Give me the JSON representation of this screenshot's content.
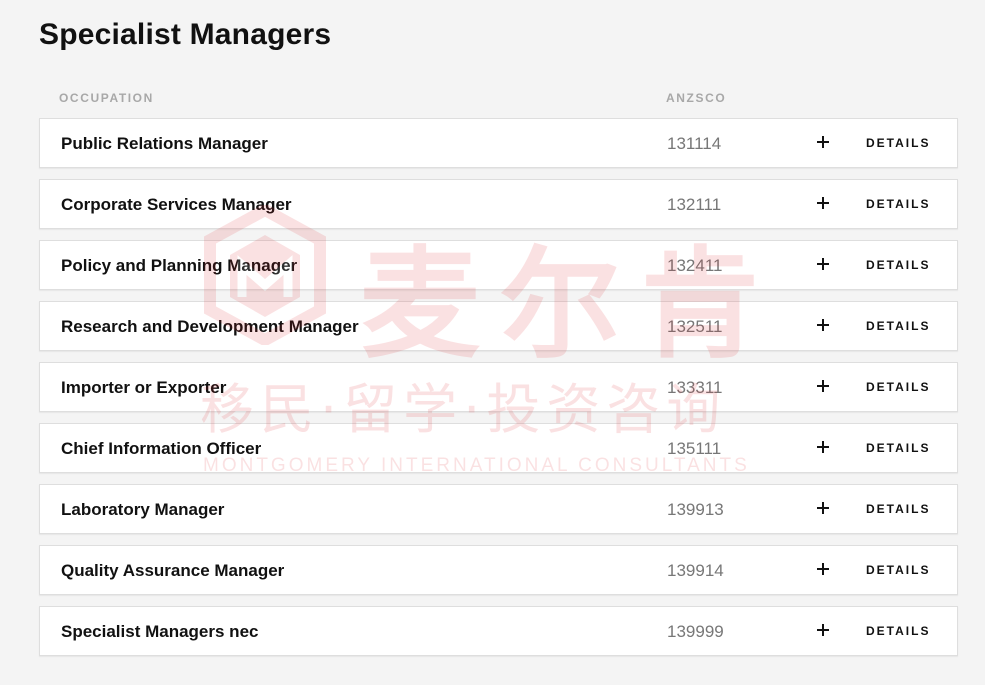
{
  "page": {
    "title": "Specialist Managers"
  },
  "columns": {
    "occupation": "OCCUPATION",
    "anzsco": "ANZSCO"
  },
  "rows": [
    {
      "name": "Public Relations Manager",
      "code": "131114",
      "details_label": "DETAILS"
    },
    {
      "name": "Corporate Services Manager",
      "code": "132111",
      "details_label": "DETAILS"
    },
    {
      "name": "Policy and Planning Manager",
      "code": "132411",
      "details_label": "DETAILS"
    },
    {
      "name": "Research and Development Manager",
      "code": "132511",
      "details_label": "DETAILS"
    },
    {
      "name": "Importer or Exporter",
      "code": "133311",
      "details_label": "DETAILS"
    },
    {
      "name": "Chief Information Officer",
      "code": "135111",
      "details_label": "DETAILS"
    },
    {
      "name": "Laboratory Manager",
      "code": "139913",
      "details_label": "DETAILS"
    },
    {
      "name": "Quality Assurance Manager",
      "code": "139914",
      "details_label": "DETAILS"
    },
    {
      "name": "Specialist Managers nec",
      "code": "139999",
      "details_label": "DETAILS"
    }
  ],
  "watermark": {
    "main": "麦尔肯",
    "sub": "移民·留学·投资咨询",
    "english": "MONTGOMERY INTERNATIONAL CONSULTANTS",
    "icon": "montgomery-logo-icon",
    "color": "#e0242b"
  },
  "icons": {
    "expand": "plus-icon"
  }
}
